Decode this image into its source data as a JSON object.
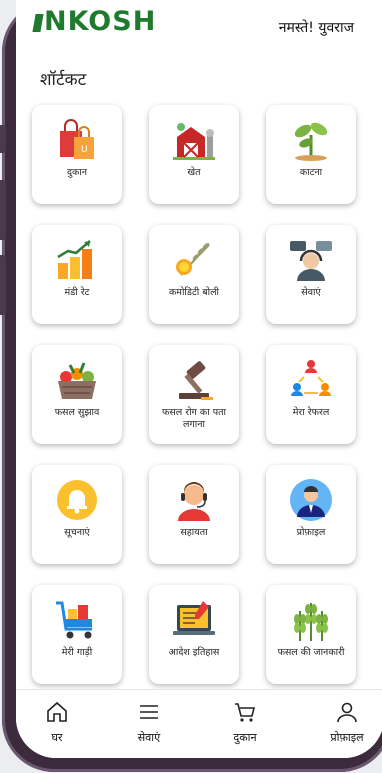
{
  "header": {
    "logo_text": "NKOSH",
    "greeting": "नमस्ते! युवराज"
  },
  "section": {
    "title": "शॉर्टकट"
  },
  "shortcuts": [
    {
      "label": "दुकान",
      "icon": "shopping-bag-icon"
    },
    {
      "label": "खेत",
      "icon": "barn-icon"
    },
    {
      "label": "काटना",
      "icon": "plant-sprout-icon"
    },
    {
      "label": "मंडी रेट",
      "icon": "market-rate-chart-icon"
    },
    {
      "label": "कमोडिटी बोली",
      "icon": "commodity-grain-icon"
    },
    {
      "label": "सेवाएं",
      "icon": "support-agent-icon"
    },
    {
      "label": "फसल सुझाव",
      "icon": "vegetable-basket-icon"
    },
    {
      "label": "फसल रोग का पता लगाना",
      "icon": "gavel-icon"
    },
    {
      "label": "मेरा रेफरल",
      "icon": "referral-network-icon"
    },
    {
      "label": "सूचनाएं",
      "icon": "bell-icon"
    },
    {
      "label": "सहायता",
      "icon": "headset-agent-icon"
    },
    {
      "label": "प्रोफ़ाइल",
      "icon": "profile-avatar-icon"
    },
    {
      "label": "मेरी गाड़ी",
      "icon": "shopping-cart-icon"
    },
    {
      "label": "आदेश इतिहास",
      "icon": "order-history-icon"
    },
    {
      "label": "फसल की जानकारी",
      "icon": "wheat-icon"
    }
  ],
  "nav": [
    {
      "label": "घर",
      "icon": "home-icon"
    },
    {
      "label": "सेवाएं",
      "icon": "menu-icon"
    },
    {
      "label": "दुकान",
      "icon": "cart-icon"
    },
    {
      "label": "प्रोफ़ाइल",
      "icon": "user-icon"
    }
  ],
  "colors": {
    "brand": "#1f7a2e",
    "frame": "#3c2b3d"
  }
}
